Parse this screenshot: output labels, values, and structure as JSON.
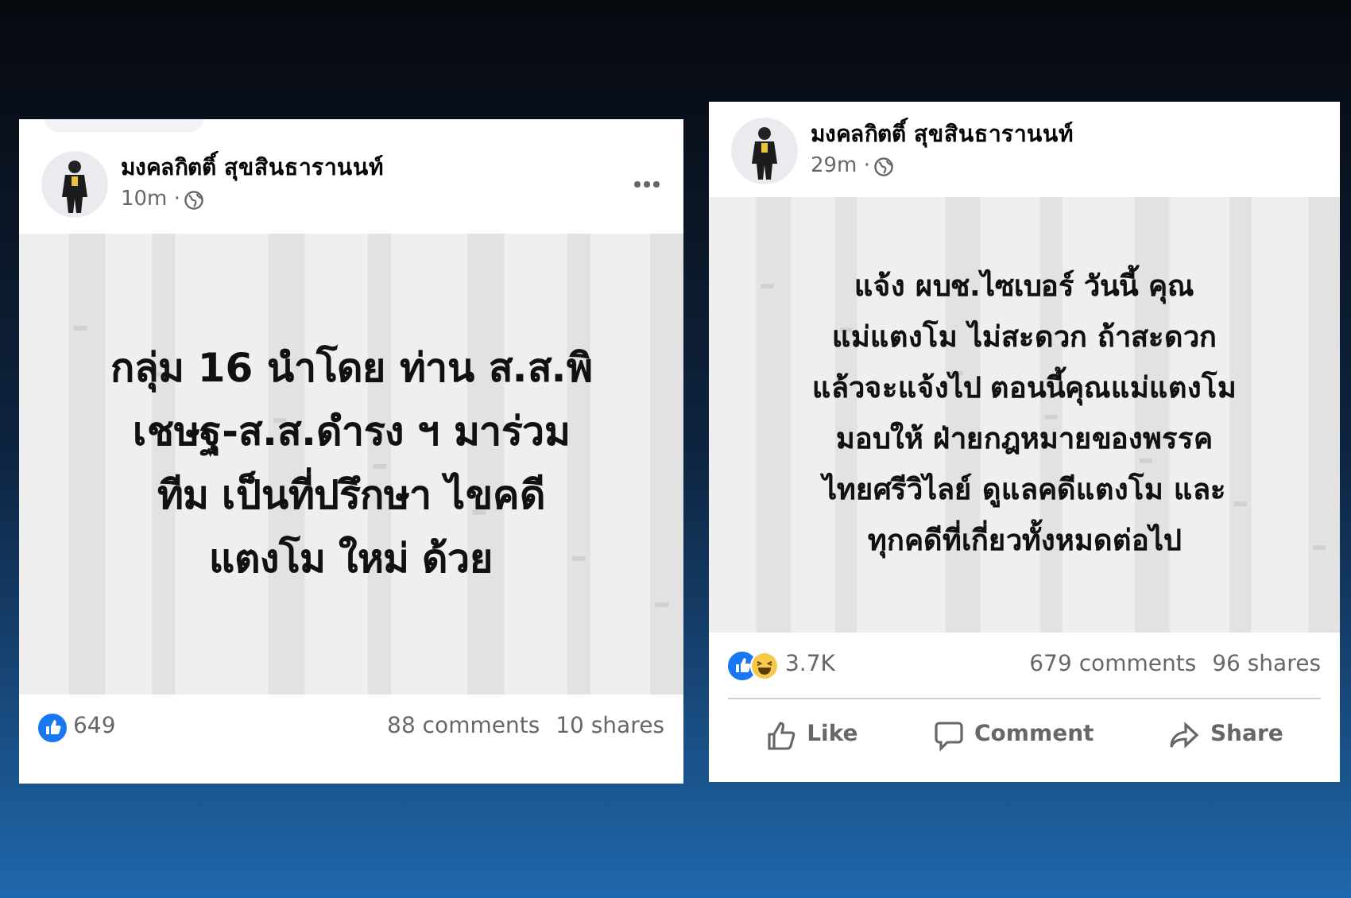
{
  "posts": [
    {
      "author": "มงคลกิตติ์ สุขสินธารานนท์",
      "time": "10m ·",
      "show_menu": true,
      "body_lines": [
        "กลุ่ม 16 นำโดย ท่าน ส.ส.พิ",
        "เชษฐ-ส.ส.ดำรง ฯ มาร่วม",
        "ทีม เป็นที่ปรึกษา ไขคดี",
        "แตงโม ใหม่ ด้วย"
      ],
      "reactions": [
        {
          "kind": "like"
        }
      ],
      "reaction_count": "649",
      "comments": "88 comments",
      "shares": "10 shares"
    },
    {
      "author": "มงคลกิตติ์ สุขสินธารานนท์",
      "time": "29m ·",
      "show_menu": false,
      "body_lines": [
        "แจ้ง ผบช.ไซเบอร์ วันนี้ คุณ",
        "แม่แตงโม ไม่สะดวก ถ้าสะดวก",
        "แล้วจะแจ้งไป ตอนนี้คุณแม่แตงโม",
        "มอบให้ ฝ่ายกฎหมายของพรรค",
        "ไทยศรีวิไลย์ ดูแลคดีแตงโม และ",
        "ทุกคดีที่เกี่ยวทั้งหมดต่อไป"
      ],
      "reactions": [
        {
          "kind": "like"
        },
        {
          "kind": "haha"
        }
      ],
      "reaction_count": "3.7K",
      "comments": "679 comments",
      "shares": "96 shares",
      "actions": [
        {
          "kind": "like",
          "label": "Like"
        },
        {
          "kind": "comment",
          "label": "Comment"
        },
        {
          "kind": "share",
          "label": "Share"
        }
      ]
    }
  ]
}
